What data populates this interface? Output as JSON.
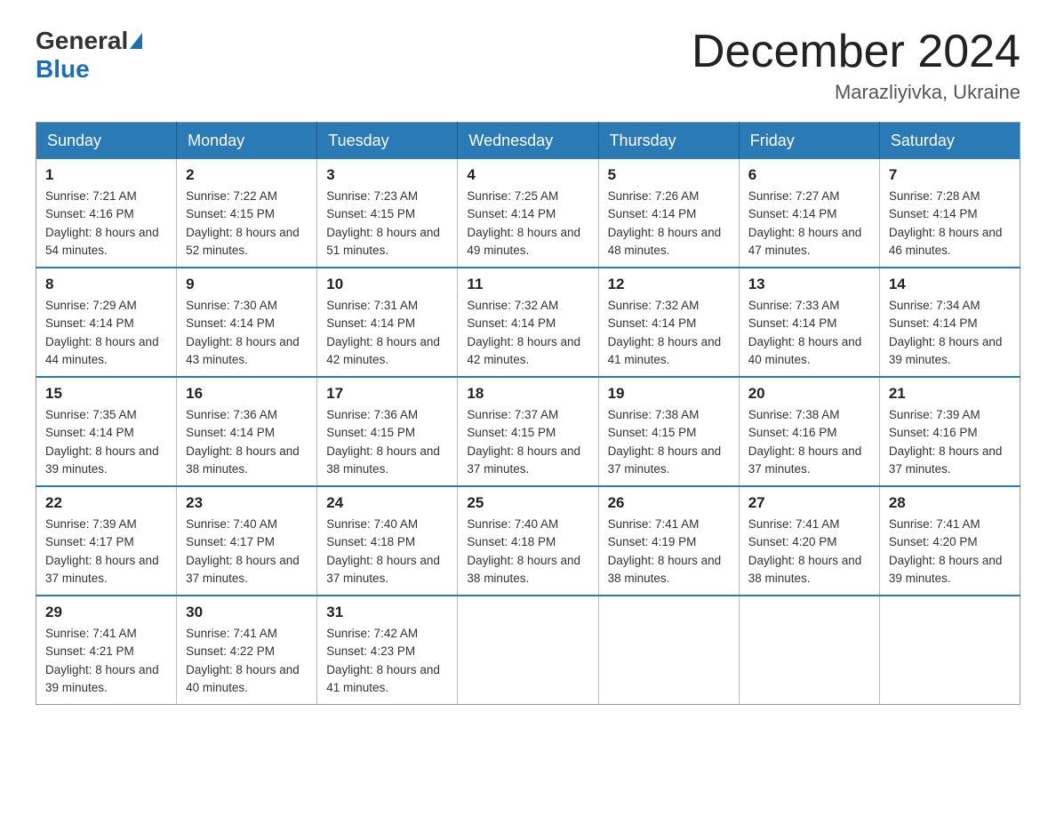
{
  "header": {
    "logo_general": "General",
    "logo_blue": "Blue",
    "month_title": "December 2024",
    "location": "Marazliyivka, Ukraine"
  },
  "weekdays": [
    "Sunday",
    "Monday",
    "Tuesday",
    "Wednesday",
    "Thursday",
    "Friday",
    "Saturday"
  ],
  "weeks": [
    [
      {
        "day": "1",
        "sunrise": "7:21 AM",
        "sunset": "4:16 PM",
        "daylight": "8 hours and 54 minutes."
      },
      {
        "day": "2",
        "sunrise": "7:22 AM",
        "sunset": "4:15 PM",
        "daylight": "8 hours and 52 minutes."
      },
      {
        "day": "3",
        "sunrise": "7:23 AM",
        "sunset": "4:15 PM",
        "daylight": "8 hours and 51 minutes."
      },
      {
        "day": "4",
        "sunrise": "7:25 AM",
        "sunset": "4:14 PM",
        "daylight": "8 hours and 49 minutes."
      },
      {
        "day": "5",
        "sunrise": "7:26 AM",
        "sunset": "4:14 PM",
        "daylight": "8 hours and 48 minutes."
      },
      {
        "day": "6",
        "sunrise": "7:27 AM",
        "sunset": "4:14 PM",
        "daylight": "8 hours and 47 minutes."
      },
      {
        "day": "7",
        "sunrise": "7:28 AM",
        "sunset": "4:14 PM",
        "daylight": "8 hours and 46 minutes."
      }
    ],
    [
      {
        "day": "8",
        "sunrise": "7:29 AM",
        "sunset": "4:14 PM",
        "daylight": "8 hours and 44 minutes."
      },
      {
        "day": "9",
        "sunrise": "7:30 AM",
        "sunset": "4:14 PM",
        "daylight": "8 hours and 43 minutes."
      },
      {
        "day": "10",
        "sunrise": "7:31 AM",
        "sunset": "4:14 PM",
        "daylight": "8 hours and 42 minutes."
      },
      {
        "day": "11",
        "sunrise": "7:32 AM",
        "sunset": "4:14 PM",
        "daylight": "8 hours and 42 minutes."
      },
      {
        "day": "12",
        "sunrise": "7:32 AM",
        "sunset": "4:14 PM",
        "daylight": "8 hours and 41 minutes."
      },
      {
        "day": "13",
        "sunrise": "7:33 AM",
        "sunset": "4:14 PM",
        "daylight": "8 hours and 40 minutes."
      },
      {
        "day": "14",
        "sunrise": "7:34 AM",
        "sunset": "4:14 PM",
        "daylight": "8 hours and 39 minutes."
      }
    ],
    [
      {
        "day": "15",
        "sunrise": "7:35 AM",
        "sunset": "4:14 PM",
        "daylight": "8 hours and 39 minutes."
      },
      {
        "day": "16",
        "sunrise": "7:36 AM",
        "sunset": "4:14 PM",
        "daylight": "8 hours and 38 minutes."
      },
      {
        "day": "17",
        "sunrise": "7:36 AM",
        "sunset": "4:15 PM",
        "daylight": "8 hours and 38 minutes."
      },
      {
        "day": "18",
        "sunrise": "7:37 AM",
        "sunset": "4:15 PM",
        "daylight": "8 hours and 37 minutes."
      },
      {
        "day": "19",
        "sunrise": "7:38 AM",
        "sunset": "4:15 PM",
        "daylight": "8 hours and 37 minutes."
      },
      {
        "day": "20",
        "sunrise": "7:38 AM",
        "sunset": "4:16 PM",
        "daylight": "8 hours and 37 minutes."
      },
      {
        "day": "21",
        "sunrise": "7:39 AM",
        "sunset": "4:16 PM",
        "daylight": "8 hours and 37 minutes."
      }
    ],
    [
      {
        "day": "22",
        "sunrise": "7:39 AM",
        "sunset": "4:17 PM",
        "daylight": "8 hours and 37 minutes."
      },
      {
        "day": "23",
        "sunrise": "7:40 AM",
        "sunset": "4:17 PM",
        "daylight": "8 hours and 37 minutes."
      },
      {
        "day": "24",
        "sunrise": "7:40 AM",
        "sunset": "4:18 PM",
        "daylight": "8 hours and 37 minutes."
      },
      {
        "day": "25",
        "sunrise": "7:40 AM",
        "sunset": "4:18 PM",
        "daylight": "8 hours and 38 minutes."
      },
      {
        "day": "26",
        "sunrise": "7:41 AM",
        "sunset": "4:19 PM",
        "daylight": "8 hours and 38 minutes."
      },
      {
        "day": "27",
        "sunrise": "7:41 AM",
        "sunset": "4:20 PM",
        "daylight": "8 hours and 38 minutes."
      },
      {
        "day": "28",
        "sunrise": "7:41 AM",
        "sunset": "4:20 PM",
        "daylight": "8 hours and 39 minutes."
      }
    ],
    [
      {
        "day": "29",
        "sunrise": "7:41 AM",
        "sunset": "4:21 PM",
        "daylight": "8 hours and 39 minutes."
      },
      {
        "day": "30",
        "sunrise": "7:41 AM",
        "sunset": "4:22 PM",
        "daylight": "8 hours and 40 minutes."
      },
      {
        "day": "31",
        "sunrise": "7:42 AM",
        "sunset": "4:23 PM",
        "daylight": "8 hours and 41 minutes."
      },
      null,
      null,
      null,
      null
    ]
  ]
}
